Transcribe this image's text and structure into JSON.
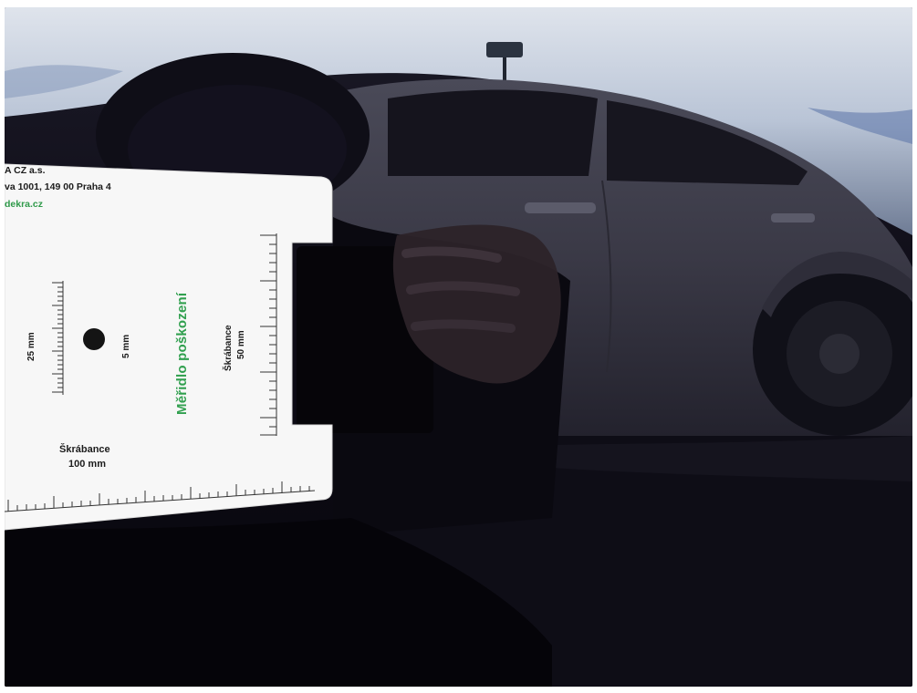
{
  "gauge": {
    "company": "A CZ a.s.",
    "address": "va 1001, 149 00 Praha 4",
    "web": "dekra.cz",
    "title": "Měřidlo poškození",
    "scale_25": "25 mm",
    "dot_5": "5 mm",
    "scratch_50_label": "Škrábance",
    "scratch_50_value": "50 mm",
    "scratch_100_label": "Škrábance",
    "scratch_100_value": "100 mm"
  },
  "colors": {
    "paint": "#0b0912",
    "sky": "#c7d0de",
    "card": "#f7f7f7",
    "brand_green": "#31a04f"
  }
}
